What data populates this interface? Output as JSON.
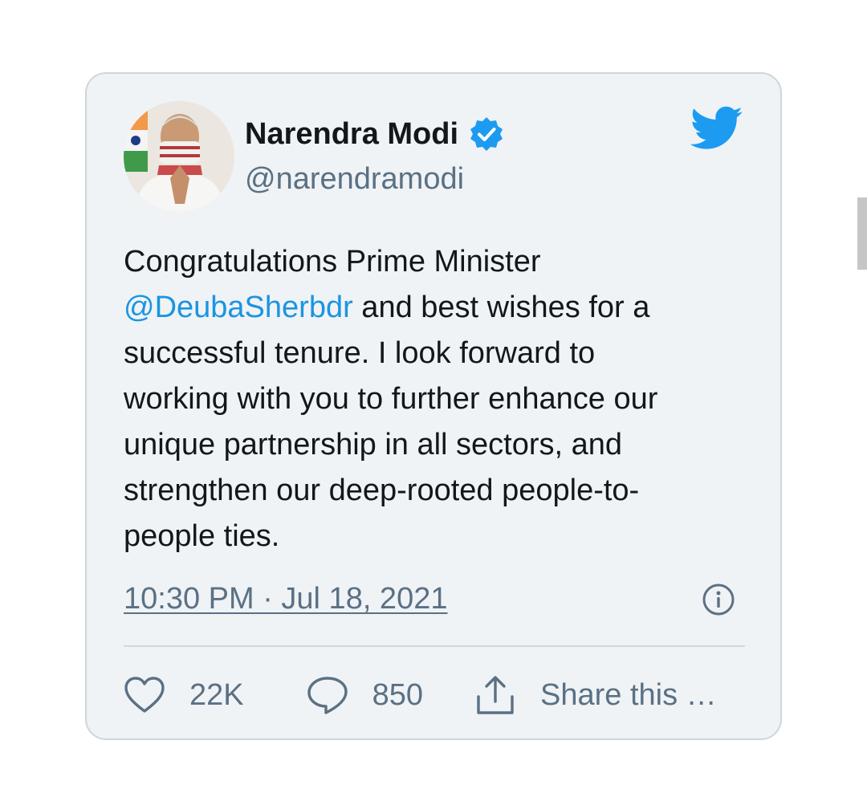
{
  "tweet": {
    "author": {
      "display_name": "Narendra Modi",
      "handle": "@narendramodi",
      "verified": true
    },
    "text_lines": [
      {
        "text": "Congratulations Prime Minister"
      },
      {
        "mention": "@DeubaSherbdr",
        "rest": " and best wishes for a"
      },
      {
        "text": "successful tenure. I look forward to"
      },
      {
        "text": "working with you to further enhance our"
      },
      {
        "text": "unique partnership in all sectors, and"
      },
      {
        "text": "strengthen our deep-rooted people-to-"
      },
      {
        "text": "people ties."
      }
    ],
    "timestamp": "10:30 PM · Jul 18, 2021",
    "likes": "22K",
    "replies": "850",
    "share_label": "Share this …"
  },
  "icons": {
    "verified": "verified-badge-icon",
    "brand": "twitter-bird-icon",
    "info": "info-icon",
    "like": "heart-icon",
    "reply": "speech-bubble-icon",
    "share": "share-upload-icon"
  },
  "colors": {
    "card_background": "#eff3f6",
    "card_border": "#cdd6dd",
    "brand_blue": "#1d9bf0",
    "mention_blue": "#1b95e0",
    "primary_text": "#14171a",
    "secondary_text": "#5b7083"
  }
}
